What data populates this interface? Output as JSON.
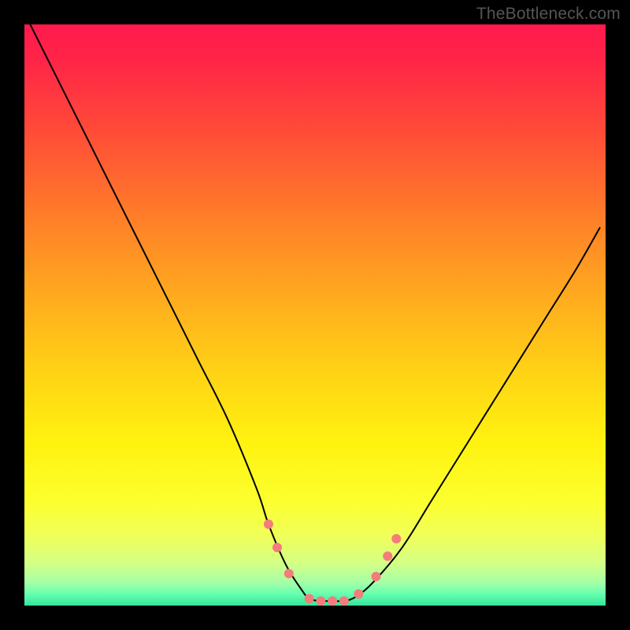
{
  "watermark": "TheBottleneck.com",
  "gradient_stops": [
    {
      "offset": 0.0,
      "color": "#ff1a4d"
    },
    {
      "offset": 0.06,
      "color": "#ff2448"
    },
    {
      "offset": 0.18,
      "color": "#ff4a38"
    },
    {
      "offset": 0.32,
      "color": "#ff7a2a"
    },
    {
      "offset": 0.46,
      "color": "#ffa81f"
    },
    {
      "offset": 0.6,
      "color": "#ffd315"
    },
    {
      "offset": 0.72,
      "color": "#fff210"
    },
    {
      "offset": 0.82,
      "color": "#fcff2e"
    },
    {
      "offset": 0.88,
      "color": "#f0ff5a"
    },
    {
      "offset": 0.925,
      "color": "#d6ff84"
    },
    {
      "offset": 0.96,
      "color": "#a6ffa6"
    },
    {
      "offset": 0.98,
      "color": "#66ffb0"
    },
    {
      "offset": 1.0,
      "color": "#33e59a"
    }
  ],
  "chart_data": {
    "type": "line",
    "title": "",
    "xlabel": "",
    "ylabel": "",
    "xlim": [
      0,
      100
    ],
    "ylim": [
      0,
      100
    ],
    "legend": false,
    "grid": false,
    "series": [
      {
        "name": "curve",
        "color": "#000000",
        "stroke_width": 2.0,
        "x": [
          1,
          5,
          10,
          15,
          20,
          25,
          30,
          35,
          40,
          42,
          45,
          47.5,
          49,
          51,
          53,
          55,
          57,
          60,
          65,
          70,
          75,
          80,
          85,
          90,
          95,
          99
        ],
        "y": [
          100,
          92,
          82,
          72,
          62,
          52,
          42,
          32,
          20,
          14,
          7,
          3,
          1.2,
          0.8,
          0.8,
          0.8,
          1.5,
          4,
          10,
          18,
          26,
          34,
          42,
          50,
          58,
          65
        ]
      }
    ],
    "markers": {
      "color": "#f47c7c",
      "radius_px": 6,
      "points": [
        {
          "x": 42.0,
          "y": 14.0
        },
        {
          "x": 43.5,
          "y": 10.0
        },
        {
          "x": 45.5,
          "y": 5.5
        },
        {
          "x": 49.0,
          "y": 1.2
        },
        {
          "x": 51.0,
          "y": 0.8
        },
        {
          "x": 53.0,
          "y": 0.8
        },
        {
          "x": 55.0,
          "y": 0.8
        },
        {
          "x": 57.5,
          "y": 2.0
        },
        {
          "x": 60.5,
          "y": 5.0
        },
        {
          "x": 62.5,
          "y": 8.5
        },
        {
          "x": 64.0,
          "y": 11.5
        }
      ]
    }
  }
}
